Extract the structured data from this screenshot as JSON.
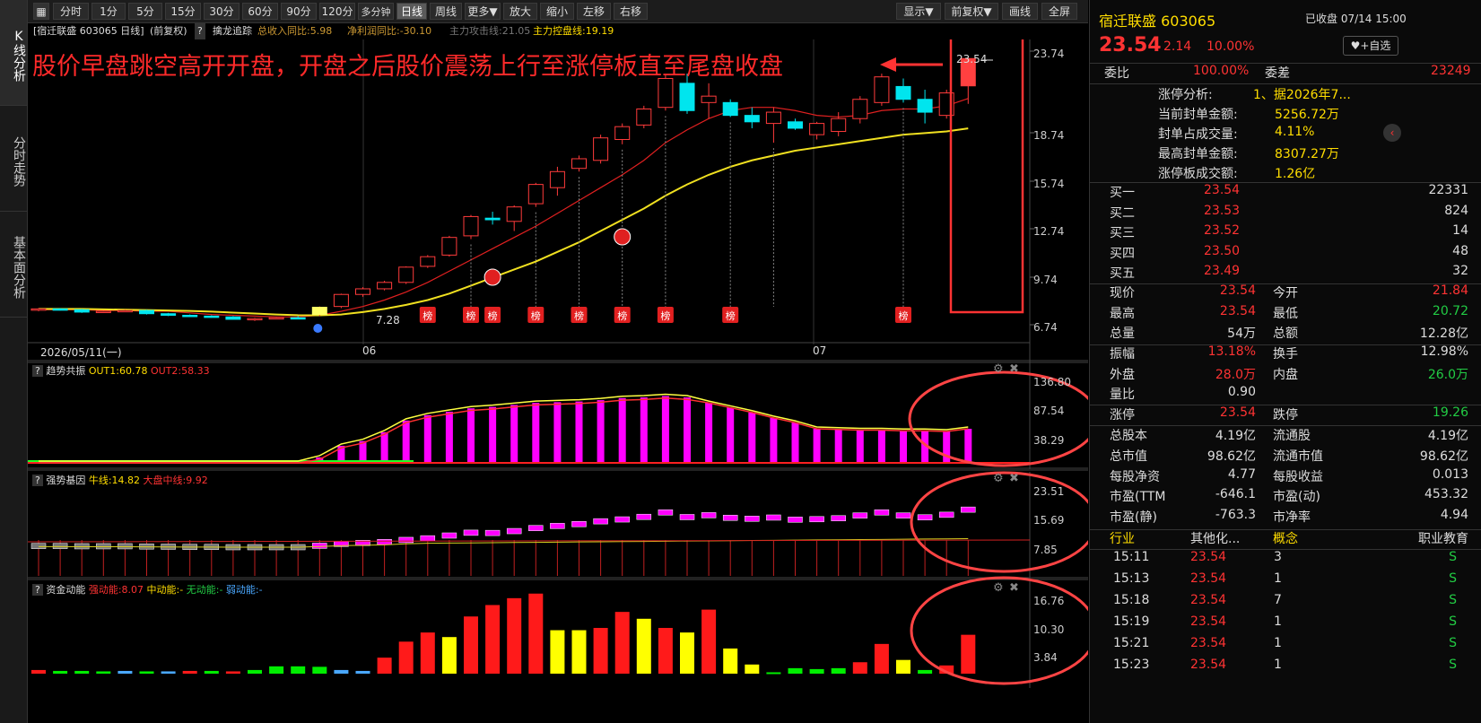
{
  "nav": {
    "tabs": [
      "K线分析",
      "分时走势",
      "基本面分析"
    ]
  },
  "toolbar": {
    "left": [
      "分时",
      "1分",
      "5分",
      "15分",
      "30分",
      "60分",
      "90分",
      "120分",
      "多分钟",
      "日线",
      "周线",
      "更多▼",
      "放大",
      "缩小",
      "左移",
      "右移"
    ],
    "right": [
      "显示▼",
      "前复权▼",
      "画线",
      "全屏"
    ],
    "active": "日线"
  },
  "infobar": {
    "stock": "[宿迁联盛 603065 日线]",
    "adj": "(前复权)",
    "q": "?",
    "indicator": "擒龙追踪",
    "rev": "总收入同比:5.98",
    "profit": "净利润同比:-30.10",
    "attack": "主力攻击线:21.05",
    "control": "主力控盘线:19.19"
  },
  "annotation": {
    "text": "股价早盘跳空高开开盘，开盘之后股价震荡上行至涨停板直至尾盘收盘",
    "last_price": "23.54",
    "low_mark": "7.28",
    "badge": "榜"
  },
  "main_axis": {
    "labels": [
      "23.74",
      "18.74",
      "15.74",
      "12.74",
      "9.74",
      "6.74"
    ]
  },
  "dates": {
    "start": "2026/05/11(一)",
    "m6": "06",
    "m7": "07"
  },
  "sub1": {
    "name": "趋势共振",
    "out1": "OUT1:60.78",
    "out2": "OUT2:58.33",
    "axis": [
      "136.80",
      "87.54",
      "38.29"
    ]
  },
  "sub2": {
    "name": "强势基因",
    "bull": "牛线:14.82",
    "mid": "大盘中线:9.92",
    "axis": [
      "23.51",
      "15.69",
      "7.85"
    ]
  },
  "sub3": {
    "name": "资金动能",
    "strong": "强动能:8.07",
    "midv": "中动能:-",
    "none": "无动能:-",
    "weak": "弱动能:-",
    "axis": [
      "16.76",
      "10.30",
      "3.84"
    ]
  },
  "chart_data": {
    "type": "bar",
    "title": "宿迁联盛 603065 日线",
    "candles": [
      [
        7.9,
        8.0,
        7.8,
        7.95
      ],
      [
        7.95,
        8.0,
        7.85,
        7.9
      ],
      [
        7.9,
        7.95,
        7.7,
        7.75
      ],
      [
        7.75,
        7.85,
        7.7,
        7.8
      ],
      [
        7.8,
        7.9,
        7.75,
        7.85
      ],
      [
        7.85,
        7.9,
        7.6,
        7.65
      ],
      [
        7.65,
        7.7,
        7.5,
        7.55
      ],
      [
        7.55,
        7.6,
        7.45,
        7.5
      ],
      [
        7.5,
        7.55,
        7.4,
        7.45
      ],
      [
        7.45,
        7.5,
        7.28,
        7.3
      ],
      [
        7.3,
        7.4,
        7.2,
        7.35
      ],
      [
        7.35,
        7.45,
        7.3,
        7.4
      ],
      [
        7.4,
        7.5,
        7.3,
        7.35
      ],
      [
        7.6,
        8.1,
        7.5,
        8.05
      ],
      [
        8.1,
        8.9,
        8.0,
        8.85
      ],
      [
        8.85,
        9.3,
        8.7,
        9.2
      ],
      [
        9.2,
        9.7,
        9.1,
        9.6
      ],
      [
        9.6,
        10.6,
        9.5,
        10.55
      ],
      [
        10.6,
        11.3,
        10.5,
        11.2
      ],
      [
        11.3,
        12.5,
        11.2,
        12.4
      ],
      [
        12.5,
        13.8,
        12.3,
        13.7
      ],
      [
        13.6,
        14.0,
        13.2,
        13.5
      ],
      [
        13.4,
        14.4,
        12.8,
        14.3
      ],
      [
        14.5,
        15.8,
        14.3,
        15.7
      ],
      [
        15.5,
        16.8,
        15.0,
        16.5
      ],
      [
        16.7,
        17.5,
        16.5,
        17.3
      ],
      [
        17.2,
        18.8,
        17.0,
        18.6
      ],
      [
        18.5,
        19.5,
        18.2,
        19.3
      ],
      [
        19.4,
        20.6,
        19.2,
        20.4
      ],
      [
        20.5,
        22.5,
        20.3,
        22.3
      ],
      [
        22.0,
        22.6,
        20.1,
        20.3
      ],
      [
        20.8,
        22.0,
        19.8,
        21.2
      ],
      [
        20.8,
        21.0,
        19.9,
        20.0
      ],
      [
        20.0,
        20.5,
        19.2,
        19.6
      ],
      [
        19.5,
        20.5,
        18.3,
        20.2
      ],
      [
        19.6,
        19.8,
        19.1,
        19.2
      ],
      [
        18.8,
        19.6,
        18.5,
        19.5
      ],
      [
        19.0,
        20.2,
        18.7,
        19.8
      ],
      [
        19.8,
        21.2,
        19.5,
        21.0
      ],
      [
        20.8,
        22.6,
        20.6,
        22.4
      ],
      [
        21.8,
        22.3,
        20.8,
        21.0
      ],
      [
        21.0,
        21.6,
        19.5,
        20.2
      ],
      [
        20.0,
        21.6,
        19.8,
        21.4
      ],
      [
        21.84,
        23.54,
        20.72,
        23.54
      ]
    ],
    "sub1_bars": [
      30,
      30,
      30,
      30,
      30,
      30,
      30,
      30,
      30,
      30,
      30,
      30,
      30,
      38,
      55,
      62,
      75,
      92,
      100,
      105,
      110,
      112,
      115,
      118,
      119,
      120,
      122,
      125,
      126,
      128,
      126,
      118,
      111,
      104,
      96,
      89,
      80,
      79,
      78,
      78,
      77,
      77,
      76,
      80
    ],
    "sub2_boxes": [
      7.9,
      7.9,
      7.8,
      7.8,
      7.8,
      7.7,
      7.6,
      7.5,
      7.5,
      7.4,
      7.4,
      7.4,
      7.4,
      8.0,
      8.8,
      9.2,
      9.6,
      10.5,
      11.2,
      12.4,
      13.6,
      13.5,
      14.3,
      15.6,
      16.5,
      17.3,
      18.5,
      19.3,
      20.4,
      22.3,
      20.3,
      21.1,
      20.0,
      19.6,
      20.1,
      19.2,
      19.4,
      19.8,
      21.0,
      22.3,
      21.0,
      20.2,
      21.3,
      23.5
    ],
    "sub3_bars": [
      [
        0.8,
        "red"
      ],
      [
        0.6,
        "green"
      ],
      [
        0.6,
        "green"
      ],
      [
        0.5,
        "green"
      ],
      [
        0.6,
        "blue"
      ],
      [
        0.5,
        "green"
      ],
      [
        0.5,
        "blue"
      ],
      [
        0.6,
        "red"
      ],
      [
        0.6,
        "green"
      ],
      [
        0.5,
        "red"
      ],
      [
        0.8,
        "green"
      ],
      [
        1.6,
        "green"
      ],
      [
        1.6,
        "green"
      ],
      [
        1.5,
        "green"
      ],
      [
        0.8,
        "blue"
      ],
      [
        0.6,
        "blue"
      ],
      [
        3.5,
        "red"
      ],
      [
        7.0,
        "red"
      ],
      [
        9.0,
        "red"
      ],
      [
        8.0,
        "yellow"
      ],
      [
        12.5,
        "red"
      ],
      [
        15.0,
        "red"
      ],
      [
        16.5,
        "red"
      ],
      [
        17.5,
        "red"
      ],
      [
        9.5,
        "yellow"
      ],
      [
        9.5,
        "yellow"
      ],
      [
        10.0,
        "red"
      ],
      [
        13.5,
        "red"
      ],
      [
        12.0,
        "yellow"
      ],
      [
        10.0,
        "red"
      ],
      [
        9.0,
        "yellow"
      ],
      [
        14.0,
        "red"
      ],
      [
        5.5,
        "yellow"
      ],
      [
        2.0,
        "yellow"
      ],
      [
        0.3,
        "green"
      ],
      [
        1.2,
        "green"
      ],
      [
        1.0,
        "green"
      ],
      [
        1.2,
        "green"
      ],
      [
        2.5,
        "red"
      ],
      [
        6.5,
        "red"
      ],
      [
        3.0,
        "yellow"
      ],
      [
        0.8,
        "green"
      ],
      [
        1.8,
        "red"
      ],
      [
        8.5,
        "red"
      ]
    ],
    "ma_attack": [
      7.9,
      7.9,
      7.9,
      7.85,
      7.85,
      7.8,
      7.8,
      7.7,
      7.6,
      7.55,
      7.5,
      7.45,
      7.45,
      7.55,
      7.8,
      8.1,
      8.5,
      9.0,
      9.6,
      10.3,
      11.0,
      11.7,
      12.4,
      13.1,
      13.9,
      14.7,
      15.5,
      16.3,
      17.2,
      18.3,
      19.1,
      19.8,
      20.3,
      20.5,
      20.5,
      20.3,
      20.0,
      19.9,
      20.0,
      20.3,
      20.4,
      20.4,
      20.6,
      21.05
    ],
    "ma_control": [
      7.95,
      7.95,
      7.95,
      7.92,
      7.9,
      7.88,
      7.85,
      7.82,
      7.78,
      7.72,
      7.66,
      7.6,
      7.56,
      7.55,
      7.6,
      7.75,
      7.95,
      8.2,
      8.5,
      8.9,
      9.4,
      9.9,
      10.4,
      10.9,
      11.5,
      12.1,
      12.8,
      13.5,
      14.2,
      15.0,
      15.7,
      16.3,
      16.8,
      17.2,
      17.5,
      17.8,
      18.0,
      18.2,
      18.4,
      18.6,
      18.8,
      18.9,
      19.0,
      19.19
    ],
    "badges": [
      18,
      20,
      21,
      23,
      25,
      27,
      29,
      32,
      40
    ],
    "dashed": [
      20,
      23,
      25,
      27,
      29,
      32,
      34,
      40
    ]
  },
  "panel": {
    "name": "宿迁联盛 603065",
    "status": "已收盘 07/14 15:00",
    "price": "23.54",
    "change": "2.14",
    "pct": "10.00%",
    "fav": "+自选",
    "wb_label": "委比",
    "wb": "100.00%",
    "wc_label": "委差",
    "wc": "23249",
    "limit_analysis": [
      [
        "涨停分析:",
        "1、据2026年7..."
      ],
      [
        "当前封单金额:",
        "5256.72万"
      ],
      [
        "封单占成交量:",
        "4.11%"
      ],
      [
        "最高封单金额:",
        "8307.27万"
      ],
      [
        "涨停板成交额:",
        "1.26亿"
      ]
    ],
    "bids": [
      [
        "买一",
        "23.54",
        "22331"
      ],
      [
        "买二",
        "23.53",
        "824"
      ],
      [
        "买三",
        "23.52",
        "14"
      ],
      [
        "买四",
        "23.50",
        "48"
      ],
      [
        "买五",
        "23.49",
        "32"
      ]
    ],
    "stats1": [
      [
        "现价",
        "23.54",
        "red",
        "今开",
        "21.84",
        "red"
      ],
      [
        "最高",
        "23.54",
        "red",
        "最低",
        "20.72",
        "green"
      ],
      [
        "总量",
        "54万",
        "white",
        "总额",
        "12.28亿",
        "white"
      ]
    ],
    "stats2": [
      [
        "振幅",
        "13.18%",
        "red",
        "换手",
        "12.98%",
        "white"
      ],
      [
        "外盘",
        "28.0万",
        "red",
        "内盘",
        "26.0万",
        "green"
      ],
      [
        "量比",
        "0.90",
        "white",
        "",
        "",
        ""
      ]
    ],
    "limits": [
      "涨停",
      "23.54",
      "跌停",
      "19.26"
    ],
    "fundamentals": [
      [
        "总股本",
        "4.19亿",
        "流通股",
        "4.19亿"
      ],
      [
        "总市值",
        "98.62亿",
        "流通市值",
        "98.62亿"
      ],
      [
        "每股净资",
        "4.77",
        "每股收益",
        "0.013"
      ],
      [
        "市盈(TTM",
        "-646.1",
        "市盈(动)",
        "453.32"
      ],
      [
        "市盈(静)",
        "-763.3",
        "市净率",
        "4.94"
      ]
    ],
    "industry": [
      "行业",
      "其他化...",
      "概念",
      "职业教育"
    ],
    "trades": [
      [
        "15:11",
        "23.54",
        "3",
        "S"
      ],
      [
        "15:13",
        "23.54",
        "1",
        "S"
      ],
      [
        "15:18",
        "23.54",
        "7",
        "S"
      ],
      [
        "15:19",
        "23.54",
        "1",
        "S"
      ],
      [
        "15:21",
        "23.54",
        "1",
        "S"
      ],
      [
        "15:23",
        "23.54",
        "1",
        "S"
      ]
    ]
  }
}
